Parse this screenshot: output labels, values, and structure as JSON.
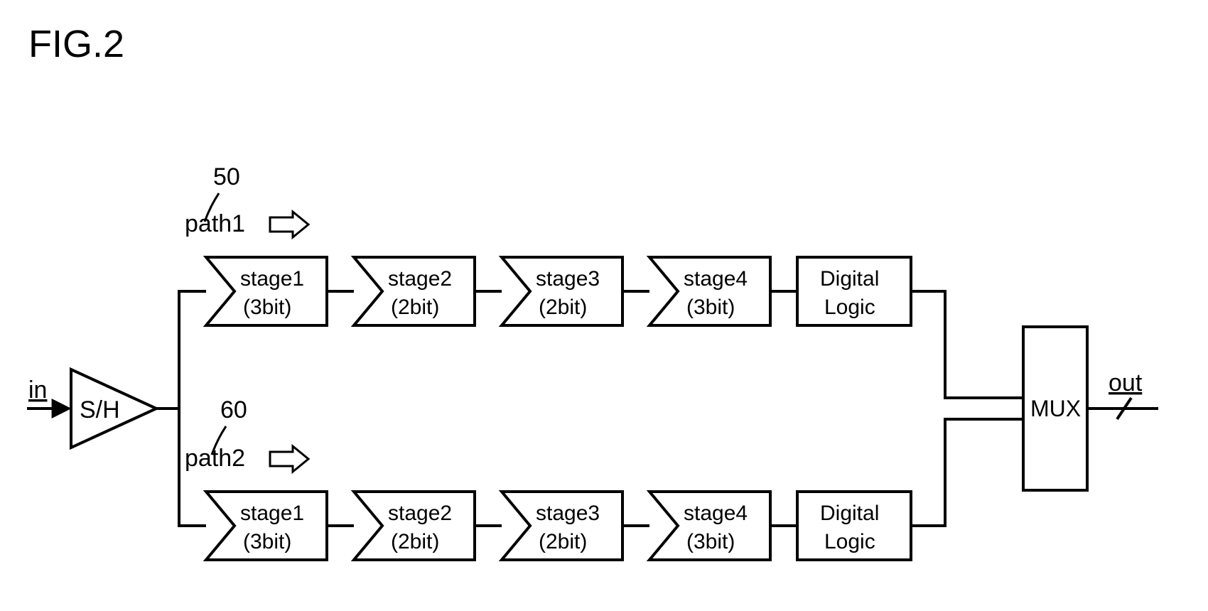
{
  "figure_label": "FIG.2",
  "input_label": "in",
  "sh_label": "S/H",
  "path1": {
    "ref": "50",
    "label": "path1"
  },
  "path2": {
    "ref": "60",
    "label": "path2"
  },
  "stages_top": [
    {
      "name": "stage1",
      "bits": "(3bit)"
    },
    {
      "name": "stage2",
      "bits": "(2bit)"
    },
    {
      "name": "stage3",
      "bits": "(2bit)"
    },
    {
      "name": "stage4",
      "bits": "(3bit)"
    }
  ],
  "stages_bot": [
    {
      "name": "stage1",
      "bits": "(3bit)"
    },
    {
      "name": "stage2",
      "bits": "(2bit)"
    },
    {
      "name": "stage3",
      "bits": "(2bit)"
    },
    {
      "name": "stage4",
      "bits": "(3bit)"
    }
  ],
  "digital_logic_label_line1": "Digital",
  "digital_logic_label_line2": "Logic",
  "mux_label": "MUX",
  "output_label": "out"
}
